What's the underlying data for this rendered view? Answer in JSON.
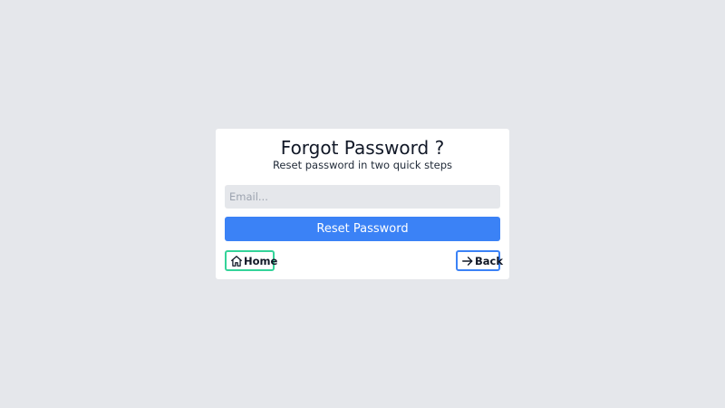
{
  "form": {
    "title": "Forgot Password ?",
    "subtitle": "Reset password in two quick steps",
    "email_placeholder": "Email...",
    "email_value": "",
    "submit_label": "Reset Password"
  },
  "nav": {
    "home_label": "Home",
    "home_icon": "home-icon",
    "back_label": "Back",
    "back_icon": "arrow-right-icon"
  },
  "colors": {
    "background": "#e5e7eb",
    "card": "#ffffff",
    "primary": "#3b82f6",
    "home_border": "#34d399",
    "back_border": "#3b82f6",
    "input_bg": "#e5e7eb"
  }
}
